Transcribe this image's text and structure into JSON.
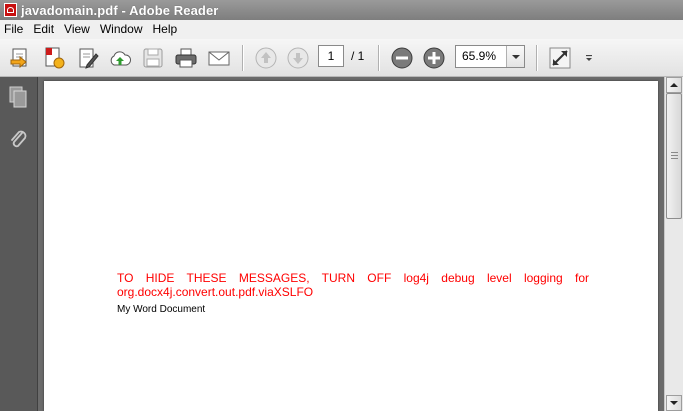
{
  "window": {
    "title": "javadomain.pdf - Adobe Reader"
  },
  "menu": [
    {
      "label": "File"
    },
    {
      "label": "Edit"
    },
    {
      "label": "View"
    },
    {
      "label": "Window"
    },
    {
      "label": "Help"
    }
  ],
  "toolbar": {
    "current_page": "1",
    "total_pages": "/ 1",
    "zoom": "65.9%"
  },
  "document": {
    "message_line1": "TO HIDE THESE MESSAGES, TURN OFF log4j debug level logging for",
    "message_line2": "org.docx4j.convert.out.pdf.viaXSLFO",
    "doc_title": "My Word Document"
  },
  "colors": {
    "message": "#ff0000",
    "titlebar": "#8c8c8c",
    "pane": "#595959"
  }
}
